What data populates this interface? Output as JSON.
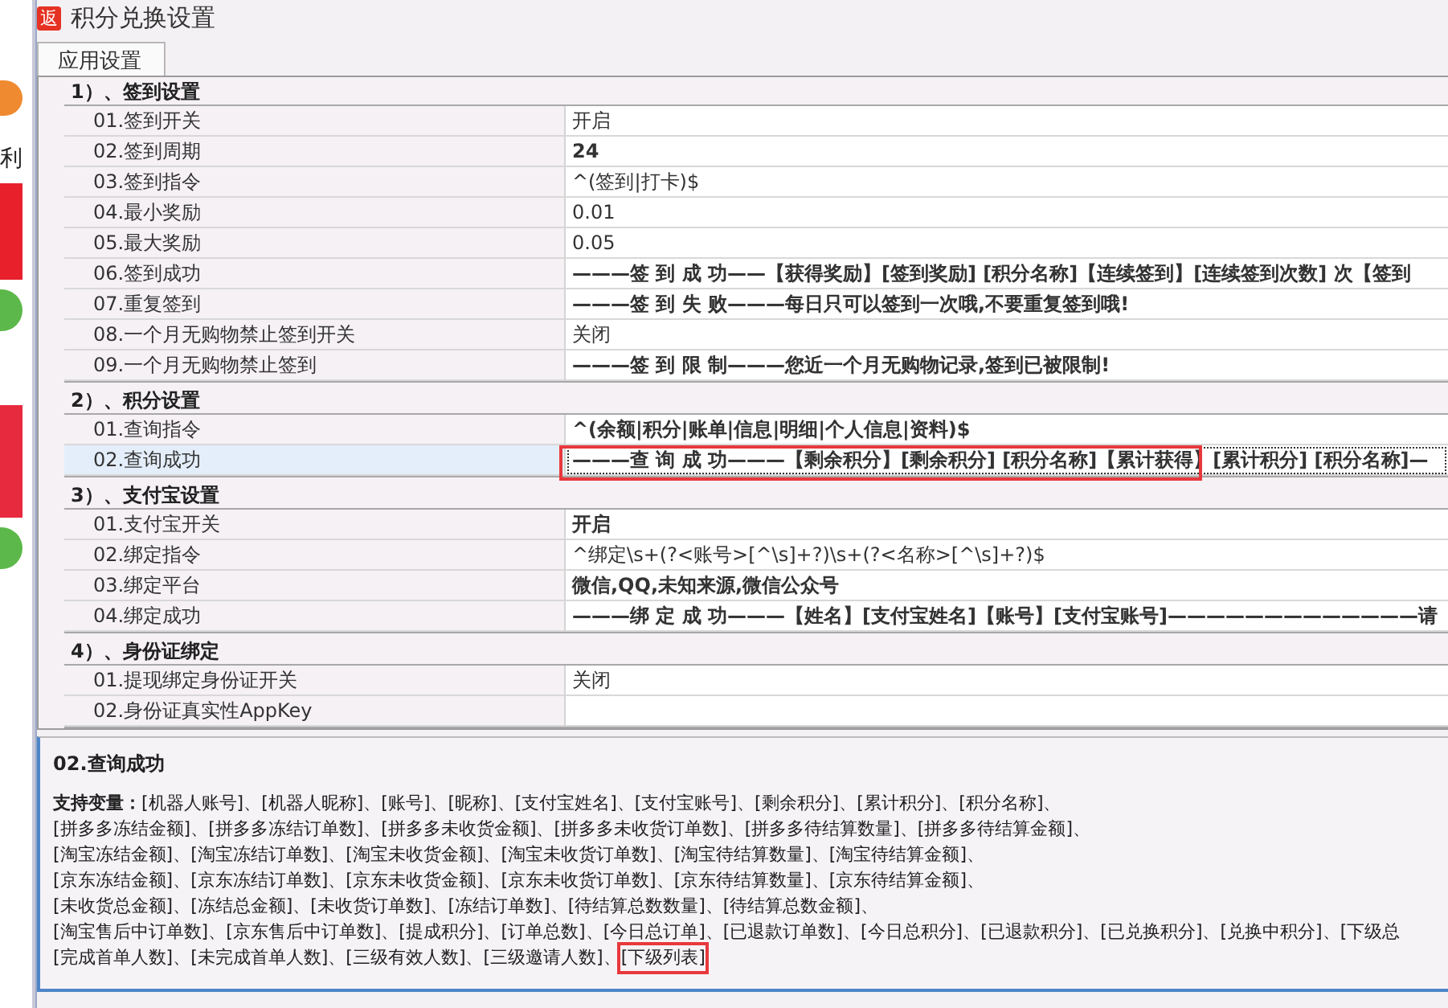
{
  "behind": {
    "text": "利"
  },
  "window": {
    "title": "积分兑换设置",
    "icon_text": "返"
  },
  "tabs": [
    {
      "label": "应用设置",
      "selected": true
    }
  ],
  "sections": [
    {
      "title": "1）、签到设置",
      "rows": [
        {
          "label": "01.签到开关",
          "value": "开启",
          "bold": false,
          "selected": false
        },
        {
          "label": "02.签到周期",
          "value": "24",
          "bold": true,
          "selected": false
        },
        {
          "label": "03.签到指令",
          "value": "^(签到|打卡)$",
          "bold": false,
          "selected": false
        },
        {
          "label": "04.最小奖励",
          "value": "0.01",
          "bold": false,
          "selected": false
        },
        {
          "label": "05.最大奖励",
          "value": "0.05",
          "bold": false,
          "selected": false
        },
        {
          "label": "06.签到成功",
          "value": "———签 到 成 功——【获得奖励】[签到奖励] [积分名称]【连续签到】[连续签到次数] 次【签到",
          "bold": true,
          "selected": false
        },
        {
          "label": "07.重复签到",
          "value": "———签 到 失 败———每日只可以签到一次哦,不要重复签到哦!",
          "bold": true,
          "selected": false
        },
        {
          "label": "08.一个月无购物禁止签到开关",
          "value": "关闭",
          "bold": false,
          "selected": false
        },
        {
          "label": "09.一个月无购物禁止签到",
          "value": "———签 到 限 制———您近一个月无购物记录,签到已被限制!",
          "bold": true,
          "selected": false
        }
      ]
    },
    {
      "title": "2）、积分设置",
      "rows": [
        {
          "label": "01.查询指令",
          "value": "^(余额|积分|账单|信息|明细|个人信息|资料)$",
          "bold": true,
          "selected": false
        },
        {
          "label": "02.查询成功",
          "value": "———查 询 成 功———【剩余积分】[剩余积分] [积分名称]【累计获得】[累计积分] [积分名称]—",
          "bold": true,
          "selected": true,
          "highlighted": true
        }
      ]
    },
    {
      "title": "3）、支付宝设置",
      "rows": [
        {
          "label": "01.支付宝开关",
          "value": "开启",
          "bold": true,
          "selected": false
        },
        {
          "label": "02.绑定指令",
          "value": "^绑定\\s+(?<账号>[^\\s]+?)\\s+(?<名称>[^\\s]+?)$",
          "bold": false,
          "selected": false
        },
        {
          "label": "03.绑定平台",
          "value": "微信,QQ,未知来源,微信公众号",
          "bold": true,
          "selected": false
        },
        {
          "label": "04.绑定成功",
          "value": "———绑 定 成 功———【姓名】[支付宝姓名]【账号】[支付宝账号]—————————————请",
          "bold": true,
          "selected": false
        }
      ]
    },
    {
      "title": "4）、身份证绑定",
      "rows": [
        {
          "label": "01.提现绑定身份证开关",
          "value": "关闭",
          "bold": false,
          "selected": false
        },
        {
          "label": "02.身份证真实性AppKey",
          "selected": false
        }
      ]
    }
  ],
  "help": {
    "title": "02.查询成功",
    "lines": [
      {
        "text": "**支持变量：**[机器人账号]、[机器人昵称]、[账号]、[昵称]、[支付宝姓名]、[支付宝账号]、[剩余积分]、[累计积分]、[积分名称]、"
      },
      {
        "text": "[拼多多冻结金额]、[拼多多冻结订单数]、[拼多多未收货金额]、[拼多多未收货订单数]、[拼多多待结算数量]、[拼多多待结算金额]、"
      },
      {
        "text": "[淘宝冻结金额]、[淘宝冻结订单数]、[淘宝未收货金额]、[淘宝未收货订单数]、[淘宝待结算数量]、[淘宝待结算金额]、"
      },
      {
        "text": "[京东冻结金额]、[京东冻结订单数]、[京东未收货金额]、[京东未收货订单数]、[京东待结算数量]、[京东待结算金额]、"
      },
      {
        "text": "[未收货总金额]、[冻结总金额]、[未收货订单数]、[冻结订单数]、[待结算总数数量]、[待结算总数金额]、"
      },
      {
        "text": "[淘宝售后中订单数]、[京东售后中订单数]、[提成积分]、[订单总数]、[今日总订单]、[已退款订单数]、[今日总积分]、[已退款积分]、[已兑换积分]、[兑换中积分]、[下级总"
      },
      {
        "text": "[完成首单人数]、[未完成首单人数]、[三级有效人数]、[三级邀请人数]、",
        "highlight": "[下级列表]"
      }
    ]
  }
}
